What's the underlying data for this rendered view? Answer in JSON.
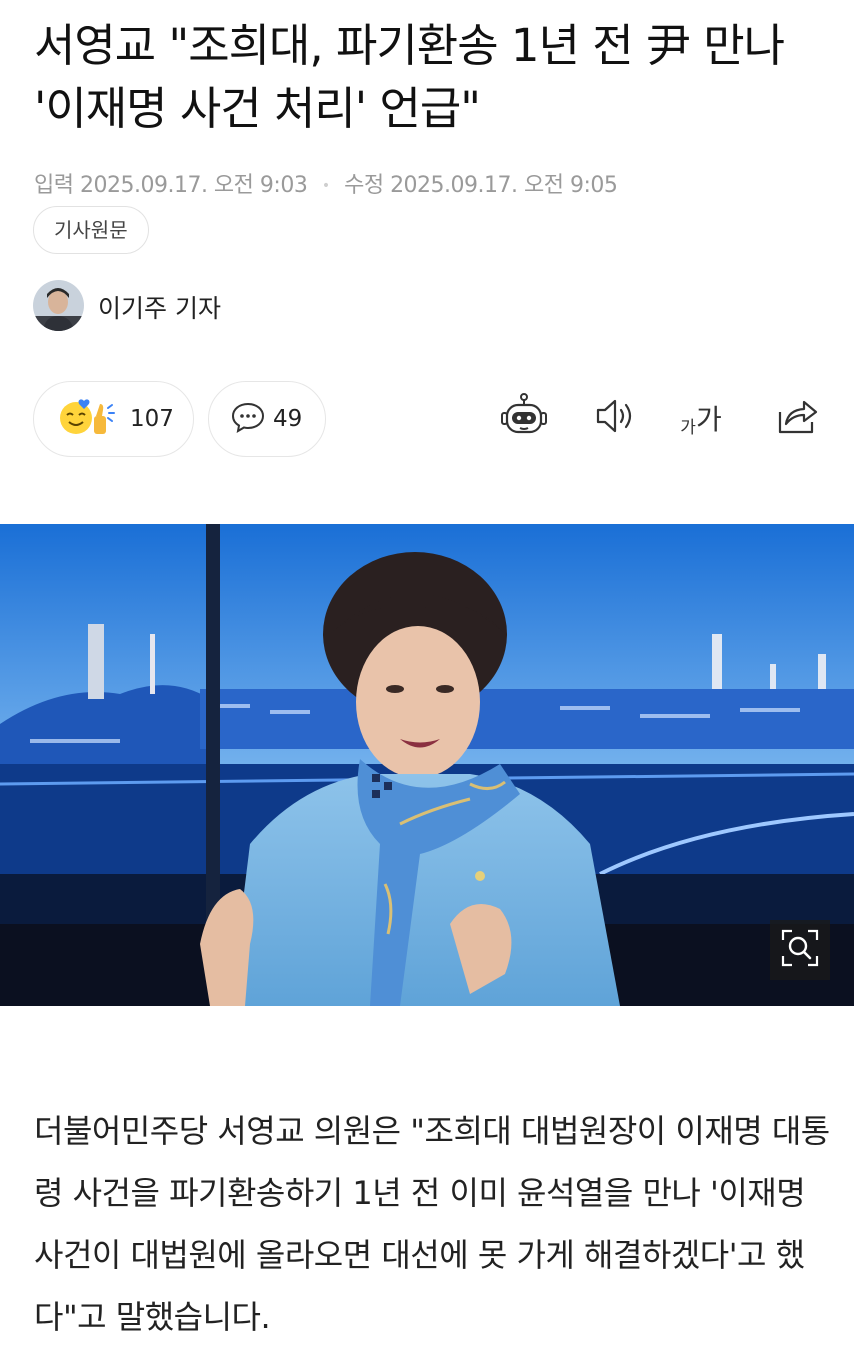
{
  "article": {
    "title": "서영교 \"조희대, 파기환송 1년 전 尹 만나 '이재명 사건 처리' 언급\"",
    "published_label": "입력",
    "published_time": "2025.09.17. 오전 9:03",
    "modified_label": "수정",
    "modified_time": "2025.09.17. 오전 9:05",
    "origin_button": "기사원문",
    "author": "이기주 기자",
    "body": "더불어민주당 서영교 의원은 \"조희대 대법원장이 이재명 대통령 사건을 파기환송하기 1년 전 이미 윤석열을 만나 '이재명 사건이 대법원에 올라오면 대선에 못 가게 해결하겠다'고 했다\"고 말했습니다."
  },
  "actions": {
    "reaction_count": "107",
    "comment_count": "49",
    "font_small_glyph": "가",
    "font_large_glyph": "가"
  },
  "icons": {
    "reaction": "reaction-emoji-icon",
    "comment": "comment-bubble-icon",
    "summary_bot": "ai-bot-icon",
    "tts": "speaker-icon",
    "font_size": "font-size-icon",
    "share": "share-icon",
    "zoom": "zoom-magnifier-icon"
  },
  "colors": {
    "accent_emoji": "#ffd43b",
    "heart": "#3b82f6",
    "text_meta": "#9a9a9a"
  }
}
